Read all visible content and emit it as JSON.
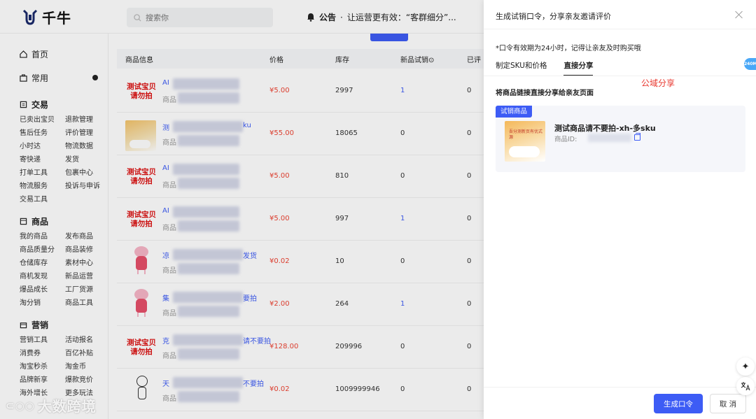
{
  "app": {
    "logo_text": "千牛",
    "search_placeholder": "搜索你"
  },
  "notice": {
    "label": "公告",
    "text": "让运营更有效：“客群细分”..."
  },
  "sidebar": {
    "home": "首页",
    "common": "常用",
    "sections": [
      {
        "title": "交易",
        "items": [
          "已卖出宝贝",
          "退款管理",
          "售后任务",
          "评价管理",
          "小时达",
          "物流数据",
          "寄快递",
          "发货",
          "打单工具",
          "包裹中心",
          "物流服务",
          "投诉与申诉",
          "交易工具"
        ]
      },
      {
        "title": "商品",
        "items": [
          "我的商品",
          "发布商品",
          "商品质量分",
          "商品装修",
          "仓储库存",
          "素材中心",
          "商机发现",
          "新品运营",
          "爆品成长",
          "工厂货源",
          "淘分销",
          "商品工具"
        ]
      },
      {
        "title": "营销",
        "items": [
          "营销工具",
          "活动报名",
          "消费券",
          "百亿补贴",
          "淘宝秒杀",
          "淘金币",
          "品牌新享",
          "爆款竞价",
          "海外增长",
          "更多玩法"
        ]
      }
    ]
  },
  "table": {
    "headers": {
      "info": "商品信息",
      "price": "价格",
      "stock": "库存",
      "trial": "新品试销⊙",
      "rated": "已评"
    },
    "rows": [
      {
        "thumb": "text",
        "thumb_text": "测试宝贝请勿拍",
        "name": "AI",
        "name_tail": "",
        "id": "商品",
        "price": "¥5.00",
        "stock": "2997",
        "trial": "1",
        "trial_link": true,
        "rated": "0"
      },
      {
        "thumb": "image",
        "thumb_text": "",
        "name": "测",
        "name_tail": "ku",
        "id": "商品",
        "price": "¥55.00",
        "stock": "18065",
        "trial": "0",
        "trial_link": false,
        "rated": "0"
      },
      {
        "thumb": "text",
        "thumb_text": "测试宝贝请勿拍",
        "name": "AI",
        "name_tail": "",
        "id": "商品",
        "price": "¥5.00",
        "stock": "810",
        "trial": "0",
        "trial_link": false,
        "rated": "0"
      },
      {
        "thumb": "text",
        "thumb_text": "测试宝贝请勿拍",
        "name": "AI",
        "name_tail": "",
        "id": "商品",
        "price": "¥5.00",
        "stock": "997",
        "trial": "1",
        "trial_link": true,
        "rated": "0"
      },
      {
        "thumb": "pig",
        "thumb_text": "",
        "name": "凉",
        "name_tail": "发货",
        "id": "商品",
        "price": "¥0.02",
        "stock": "10",
        "trial": "0",
        "trial_link": false,
        "rated": "0"
      },
      {
        "thumb": "pig",
        "thumb_text": "",
        "name": "集",
        "name_tail": "要拍",
        "id": "商品",
        "price": "¥2.00",
        "stock": "264",
        "trial": "1",
        "trial_link": true,
        "rated": "0"
      },
      {
        "thumb": "text",
        "thumb_text": "测试宝贝请勿拍",
        "name": "克",
        "name_tail": "请不要拍",
        "id": "商品",
        "price": "¥128.00",
        "stock": "209996",
        "trial": "0",
        "trial_link": false,
        "rated": "0"
      },
      {
        "thumb": "doodle",
        "thumb_text": "",
        "name": "天",
        "name_tail": "不要拍",
        "id": "商品",
        "price": "¥0.02",
        "stock": "1009999946",
        "trial": "0",
        "trial_link": false,
        "rated": "0"
      }
    ]
  },
  "drawer": {
    "title": "生成试销口令，分享亲友邀请评价",
    "hint": "*口令有效期为24小时，记得让亲友及时购买哦",
    "tabs": [
      {
        "label": "制定SKU和价格",
        "active": false
      },
      {
        "label": "直接分享",
        "active": true
      }
    ],
    "annotation": "公域分享",
    "section_heading": "将商品链接直接分享给亲友页面",
    "card": {
      "badge": "试销商品",
      "name": "测试商品请不要拍-xh-多sku",
      "id_label": "商品ID: ",
      "img_text": "吾分测新页有优式源"
    },
    "primary_button": "生成口令",
    "cancel_button": "取 消"
  },
  "side_badge": "240M",
  "watermark": {
    "text": "大数跨境"
  },
  "colors": {
    "primary": "#3d5cf5",
    "annotation": "#e8382f",
    "price": "#e43"
  }
}
